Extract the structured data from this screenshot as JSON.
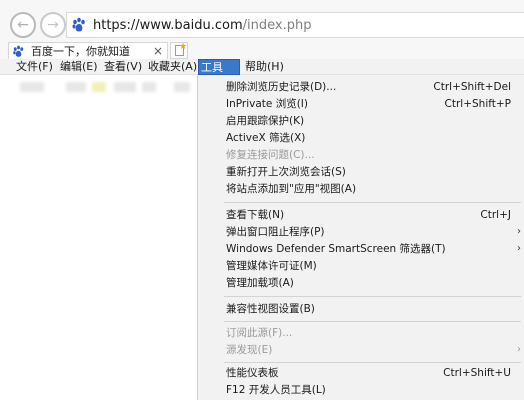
{
  "address_bar": {
    "url_host": "https://www.baidu.com",
    "url_path": "/index.php"
  },
  "tab": {
    "title": "百度一下，你就知道",
    "close": "×"
  },
  "menubar": {
    "items": [
      {
        "label": "文件(F)"
      },
      {
        "label": "编辑(E)"
      },
      {
        "label": "查看(V)"
      },
      {
        "label": "收藏夹(A)"
      },
      {
        "label": "工具(T)"
      },
      {
        "label": "帮助(H)"
      }
    ]
  },
  "tools_menu": {
    "items": [
      {
        "label": "删除浏览历史记录(D)...",
        "shortcut": "Ctrl+Shift+Del"
      },
      {
        "label": "InPrivate 浏览(I)",
        "shortcut": "Ctrl+Shift+P"
      },
      {
        "label": "启用跟踪保护(K)",
        "shortcut": ""
      },
      {
        "label": "ActiveX 筛选(X)",
        "shortcut": ""
      },
      {
        "label": "修复连接问题(C)...",
        "shortcut": ""
      },
      {
        "label": "重新打开上次浏览会话(S)",
        "shortcut": ""
      },
      {
        "label": "将站点添加到\"应用\"视图(A)",
        "shortcut": ""
      },
      {
        "label": "查看下载(N)",
        "shortcut": "Ctrl+J"
      },
      {
        "label": "弹出窗口阻止程序(P)",
        "shortcut": ""
      },
      {
        "label": "Windows Defender SmartScreen 筛选器(T)",
        "shortcut": ""
      },
      {
        "label": "管理媒体许可证(M)",
        "shortcut": ""
      },
      {
        "label": "管理加载项(A)",
        "shortcut": ""
      },
      {
        "label": "兼容性视图设置(B)",
        "shortcut": ""
      },
      {
        "label": "订阅此源(F)...",
        "shortcut": ""
      },
      {
        "label": "源发现(E)",
        "shortcut": ""
      },
      {
        "label": "性能仪表板",
        "shortcut": "Ctrl+Shift+U"
      },
      {
        "label": "F12 开发人员工具(L)",
        "shortcut": ""
      }
    ]
  }
}
